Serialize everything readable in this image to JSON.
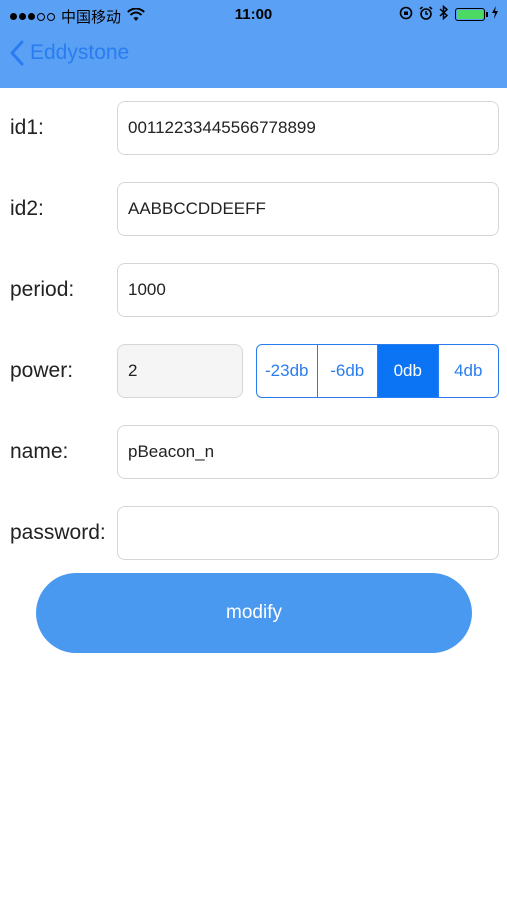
{
  "status_bar": {
    "carrier": "中国移动",
    "time": "11:00",
    "signal_dots_filled": 3,
    "signal_dots_total": 5,
    "battery_color": "#4cd964"
  },
  "nav": {
    "back_label": "Eddystone",
    "bar_color": "#5aa0f5"
  },
  "form": {
    "id1": {
      "label": "id1:",
      "value": "00112233445566778899"
    },
    "id2": {
      "label": "id2:",
      "value": "AABBCCDDEEFF"
    },
    "period": {
      "label": "period:",
      "value": "1000"
    },
    "power": {
      "label": "power:",
      "value": "2",
      "options": [
        "-23db",
        "-6db",
        "0db",
        "4db"
      ],
      "selected": "0db"
    },
    "name": {
      "label": "name:",
      "value": "pBeacon_n"
    },
    "password": {
      "label": "password:",
      "value": ""
    }
  },
  "modify_button": {
    "label": "modify",
    "color": "#4a99f0"
  }
}
